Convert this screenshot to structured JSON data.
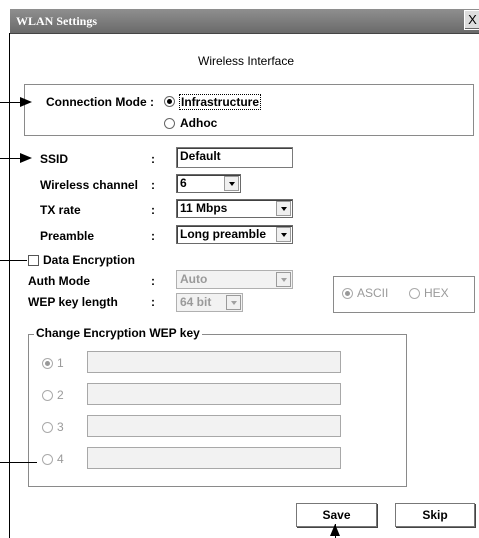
{
  "window": {
    "title": "WLAN Settings",
    "close_glyph": "X",
    "heading": "Wireless Interface"
  },
  "connection_mode": {
    "label": "Connection Mode :",
    "options": [
      "Infrastructure",
      "Adhoc"
    ],
    "selected": "Infrastructure"
  },
  "settings": {
    "ssid_label": "SSID",
    "ssid_value": "Default",
    "channel_label": "Wireless channel",
    "channel_value": "6",
    "txrate_label": "TX rate",
    "txrate_value": "11 Mbps",
    "preamble_label": "Preamble",
    "preamble_value": "Long preamble",
    "colon": ":"
  },
  "encryption": {
    "checkbox_label": "Data Encryption",
    "checked": false,
    "auth_label": "Auth Mode",
    "auth_value": "Auto",
    "wep_length_label": "WEP key length",
    "wep_length_value": "64 bit",
    "format_options": [
      "ASCII",
      "HEX"
    ],
    "format_selected": "ASCII",
    "group_title": "Change Encryption WEP key",
    "keys": [
      {
        "num": "1",
        "selected": true
      },
      {
        "num": "2",
        "selected": false
      },
      {
        "num": "3",
        "selected": false
      },
      {
        "num": "4",
        "selected": false
      }
    ]
  },
  "buttons": {
    "save": "Save",
    "skip": "Skip"
  }
}
